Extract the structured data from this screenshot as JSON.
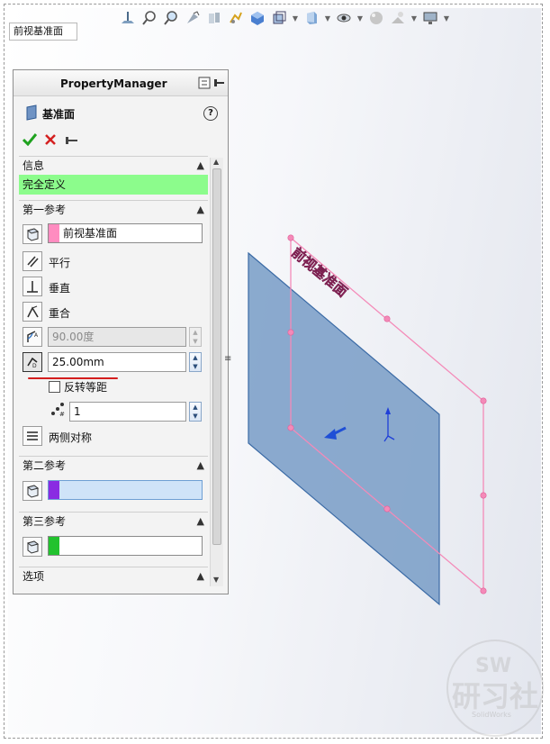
{
  "breadcrumb": "前视基准面",
  "toolbar": {
    "icons": [
      "normal-to-icon",
      "zoom-fit-icon",
      "zoom-area-icon",
      "previous-view-icon",
      "section-view-icon",
      "dynamic-annotation-icon",
      "view-orientation-icon",
      "display-style-icon",
      "hide-show-icon",
      "edit-appearance-icon",
      "apply-scene-icon",
      "view-settings-icon"
    ]
  },
  "property_manager": {
    "title": "PropertyManager",
    "feature_title": "基准面",
    "help_glyph": "?",
    "info_group": {
      "label": "信息",
      "status": "完全定义",
      "status_color": "#8cfc8c"
    },
    "first_reference": {
      "label": "第一参考",
      "selection": "前视基准面",
      "swatch_color": "#ff8cc0",
      "options": {
        "parallel": "平行",
        "perpendicular": "垂直",
        "coincident": "重合"
      },
      "angle_value": "90.00度",
      "offset_value": "25.00mm",
      "flip_offset": "反转等距",
      "count_value": "1",
      "mid_plane": "两侧对称"
    },
    "second_reference": {
      "label": "第二参考",
      "swatch_color": "#8a2be2"
    },
    "third_reference": {
      "label": "第三参考",
      "swatch_color": "#22c22e"
    },
    "options_group": {
      "label": "选项"
    }
  },
  "scene": {
    "plane_label": "前视基准面",
    "plane_fill": "#7ea1c9",
    "preview_edge": "#f48ab8"
  },
  "watermark": {
    "sw": "SW",
    "cn": "研习社",
    "small": "SolidWorks"
  }
}
